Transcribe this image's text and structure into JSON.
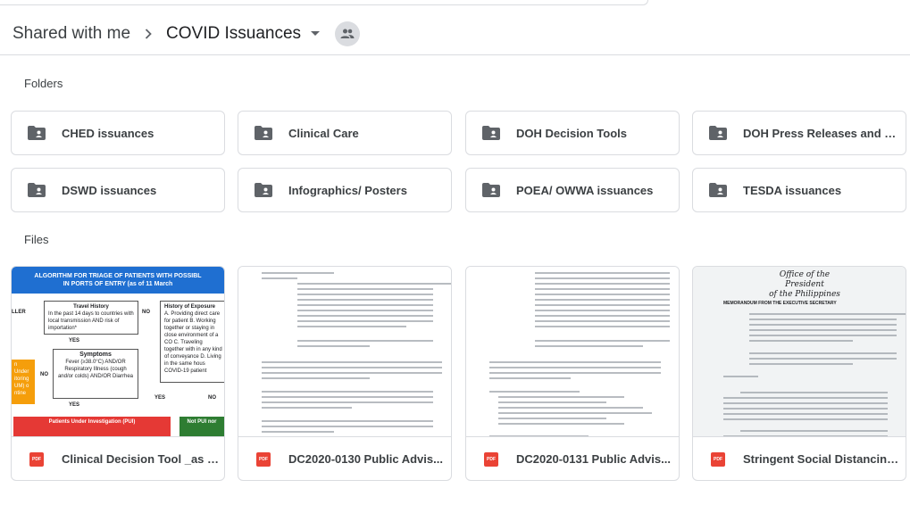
{
  "breadcrumb": {
    "parent": "Shared with me",
    "current": "COVID Issuances"
  },
  "sections": {
    "folders_label": "Folders",
    "files_label": "Files"
  },
  "folders": [
    {
      "name": "CHED issuances"
    },
    {
      "name": "Clinical Care"
    },
    {
      "name": "DOH Decision Tools"
    },
    {
      "name": "DOH Press Releases and C..."
    },
    {
      "name": "DSWD issuances"
    },
    {
      "name": "Infographics/ Posters"
    },
    {
      "name": "POEA/ OWWA issuances"
    },
    {
      "name": "TESDA issuances"
    }
  ],
  "files": [
    {
      "name": "Clinical Decision Tool _as o...",
      "type_badge": "PDF"
    },
    {
      "name": "DC2020-0130 Public Advis...",
      "type_badge": "PDF"
    },
    {
      "name": "DC2020-0131 Public Advis...",
      "type_badge": "PDF"
    },
    {
      "name": "Stringent Social Distancing ...",
      "type_badge": "PDF"
    }
  ],
  "thumb1": {
    "title_line1": "ALGORITHM FOR TRIAGE OF PATIENTS WITH POSSIBL",
    "title_line2": "IN PORTS OF ENTRY (as of 11 March",
    "travel_history": "Travel History",
    "travel_desc": "In the past 14 days to countries with local transmission AND risk of importation*",
    "no1": "NO",
    "exposure": "History of Exposure",
    "exposure_desc": "A. Providing direct care for patient B. Working together or staying in close environment of a CO C. Traveling together with in any kind of conveyance D. Living in the same hous COVID-19 patient",
    "yes1": "YES",
    "symptoms": "Symptoms",
    "symptoms_desc": "Fever (≥38.0°C) AND/OR Respiratory Illness (cough and/or colds) AND/OR Diarrhea",
    "no2": "NO",
    "yes2": "YES",
    "yes3": "YES",
    "no3": "NO",
    "pui": "Patients Under Investigation (PUI)",
    "not_pui": "Not PUI nor",
    "left_cut": "LLER",
    "orange_text": "n Under itoring UM) o ntine"
  },
  "thumb4": {
    "seal_line1": "Office of the President",
    "seal_line2": "of the Philippines",
    "memo": "MEMORANDUM FROM THE EXECUTIVE SECRETARY"
  },
  "colors": {
    "accent_blue": "#1f6fd1",
    "pdf_red": "#ea4335",
    "border": "#dadce0"
  }
}
